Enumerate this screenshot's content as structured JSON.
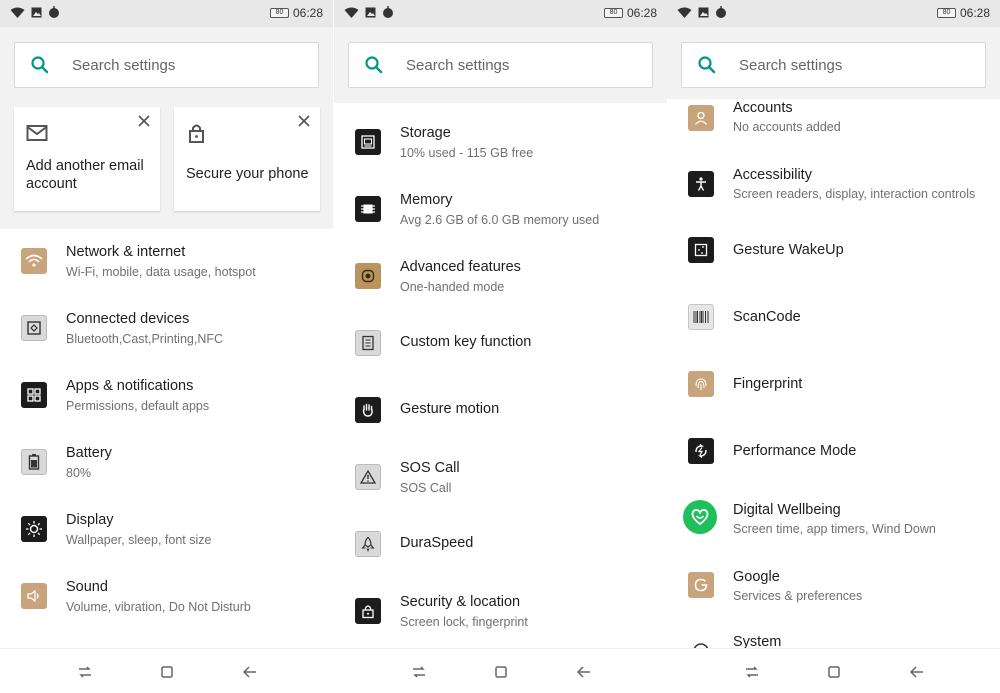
{
  "statusbar": {
    "battery": "80",
    "time": "06:28"
  },
  "search": {
    "placeholder": "Search settings"
  },
  "suggestions": [
    {
      "label": "Add another email account",
      "icon": "mail-icon"
    },
    {
      "label": "Secure your phone",
      "icon": "lock-icon"
    }
  ],
  "screen1": {
    "items": [
      {
        "title": "Network & internet",
        "sub": "Wi-Fi, mobile, data usage, hotspot",
        "icon": "wifi-icon"
      },
      {
        "title": "Connected devices",
        "sub": "Bluetooth,Cast,Printing,NFC",
        "icon": "connected-devices-icon"
      },
      {
        "title": "Apps & notifications",
        "sub": "Permissions, default apps",
        "icon": "apps-grid-icon"
      },
      {
        "title": "Battery",
        "sub": "80%",
        "icon": "battery-icon"
      },
      {
        "title": "Display",
        "sub": "Wallpaper, sleep, font size",
        "icon": "brightness-icon"
      },
      {
        "title": "Sound",
        "sub": "Volume, vibration, Do Not Disturb",
        "icon": "speaker-icon"
      }
    ]
  },
  "screen2": {
    "items": [
      {
        "title": "Storage",
        "sub": "10% used - 115 GB free",
        "icon": "storage-icon"
      },
      {
        "title": "Memory",
        "sub": "Avg 2.6 GB of 6.0 GB memory used",
        "icon": "memory-chip-icon"
      },
      {
        "title": "Advanced features",
        "sub": "One-handed mode",
        "icon": "advanced-features-icon"
      },
      {
        "title": "Custom key function",
        "sub": "",
        "icon": "custom-key-icon"
      },
      {
        "title": "Gesture motion",
        "sub": "",
        "icon": "hand-gesture-icon"
      },
      {
        "title": "SOS Call",
        "sub": "SOS Call",
        "icon": "warning-triangle-icon"
      },
      {
        "title": "DuraSpeed",
        "sub": "",
        "icon": "rocket-icon"
      },
      {
        "title": "Security & location",
        "sub": "Screen lock, fingerprint",
        "icon": "lock-icon"
      }
    ]
  },
  "screen3": {
    "items": [
      {
        "title": "Accounts",
        "sub": "No accounts added",
        "icon": "account-icon"
      },
      {
        "title": "Accessibility",
        "sub": "Screen readers, display, interaction controls",
        "icon": "accessibility-icon"
      },
      {
        "title": "Gesture WakeUp",
        "sub": "",
        "icon": "gesture-wakeup-icon"
      },
      {
        "title": "ScanCode",
        "sub": "",
        "icon": "barcode-icon"
      },
      {
        "title": "Fingerprint",
        "sub": "",
        "icon": "fingerprint-icon"
      },
      {
        "title": "Performance Mode",
        "sub": "",
        "icon": "performance-icon"
      },
      {
        "title": "Digital Wellbeing",
        "sub": "Screen time, app timers, Wind Down",
        "icon": "wellbeing-heart-icon"
      },
      {
        "title": "Google",
        "sub": "Services & preferences",
        "icon": "google-icon"
      },
      {
        "title": "System",
        "sub": "",
        "icon": "info-icon"
      }
    ]
  },
  "colors": {
    "accent": "#009688",
    "wellbeing": "#1fbf5b",
    "gold_icon": "#c8a47c",
    "dark_icon": "#1c1c1c"
  }
}
